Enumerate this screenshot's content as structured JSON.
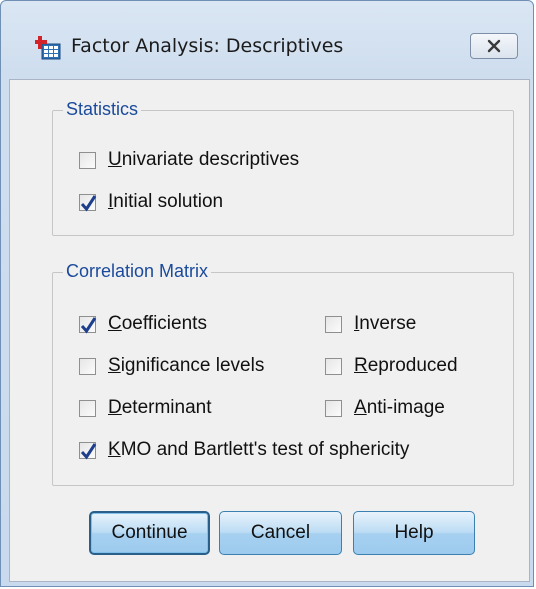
{
  "window": {
    "title": "Factor Analysis: Descriptives",
    "app_icon": "spss-factor-icon",
    "close_icon": "close-icon"
  },
  "statistics": {
    "legend": "Statistics",
    "items": [
      {
        "label_u": "U",
        "label_rest": "nivariate descriptives",
        "checked": false
      },
      {
        "label_u": "I",
        "label_rest": "nitial solution",
        "checked": true
      }
    ]
  },
  "correlation": {
    "legend": "Correlation Matrix",
    "coefficients": {
      "label_u": "C",
      "label_rest": "oefficients",
      "checked": true
    },
    "significance": {
      "label_u": "S",
      "label_rest": "ignificance levels",
      "checked": false
    },
    "determinant": {
      "label_u": "D",
      "label_rest": "eterminant",
      "checked": false
    },
    "kmo": {
      "label_u": "K",
      "label_rest": "MO and Bartlett's test of sphericity",
      "checked": true
    },
    "inverse": {
      "label_u": "I",
      "label_rest": "nverse",
      "checked": false
    },
    "reproduced": {
      "label_u": "R",
      "label_rest": "eproduced",
      "checked": false
    },
    "antiimage": {
      "label_u": "A",
      "label_rest": "nti-image",
      "checked": false
    }
  },
  "buttons": {
    "continue": "Continue",
    "cancel": "Cancel",
    "help": "Help"
  },
  "colors": {
    "legend_text": "#1a4a9c",
    "checkmark": "#1d3e8c",
    "button_border": "#3c7fb1"
  }
}
